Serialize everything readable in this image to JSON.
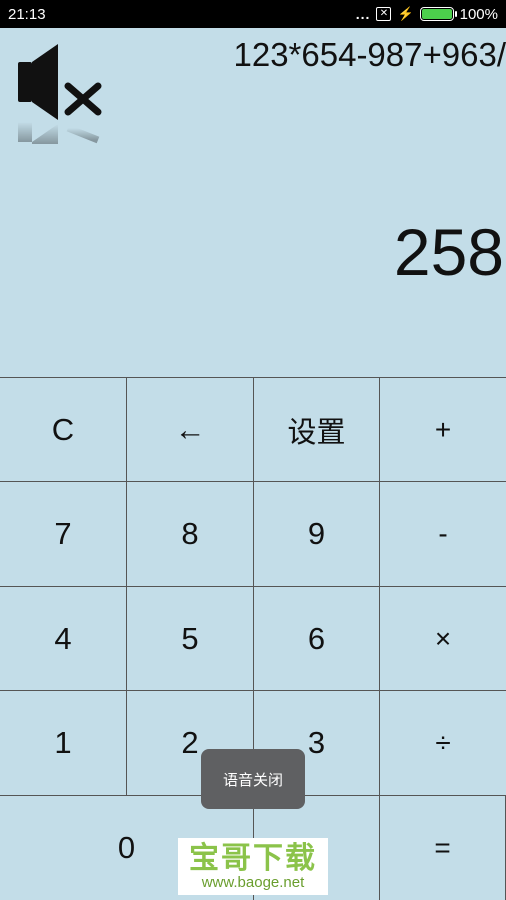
{
  "status": {
    "time": "21:13",
    "dots": "...",
    "battery_percent": "100%",
    "battery_level": 1.0
  },
  "display": {
    "expression": "123*654-987+963/",
    "result": "258"
  },
  "keys": {
    "clear": "C",
    "backspace": "←",
    "settings": "设置",
    "plus": "+",
    "seven": "7",
    "eight": "8",
    "nine": "9",
    "minus": "-",
    "four": "4",
    "five": "5",
    "six": "6",
    "multiply": "×",
    "one": "1",
    "two": "2",
    "three": "3",
    "divide": "÷",
    "zero": "0",
    "equals": "="
  },
  "toast": {
    "text": "语音关闭"
  },
  "watermark": {
    "title": "宝哥下载",
    "url": "www.baoge.net"
  },
  "colors": {
    "background": "#c3dde8",
    "status_bar": "#000000",
    "toast_bg": "#5f6062",
    "watermark_green": "#8bc34a",
    "battery_green": "#4cd04c"
  },
  "icons": {
    "mute": "speaker-muted-icon",
    "sim": "sim-x-icon",
    "charging": "lightning-icon",
    "battery": "battery-icon"
  }
}
